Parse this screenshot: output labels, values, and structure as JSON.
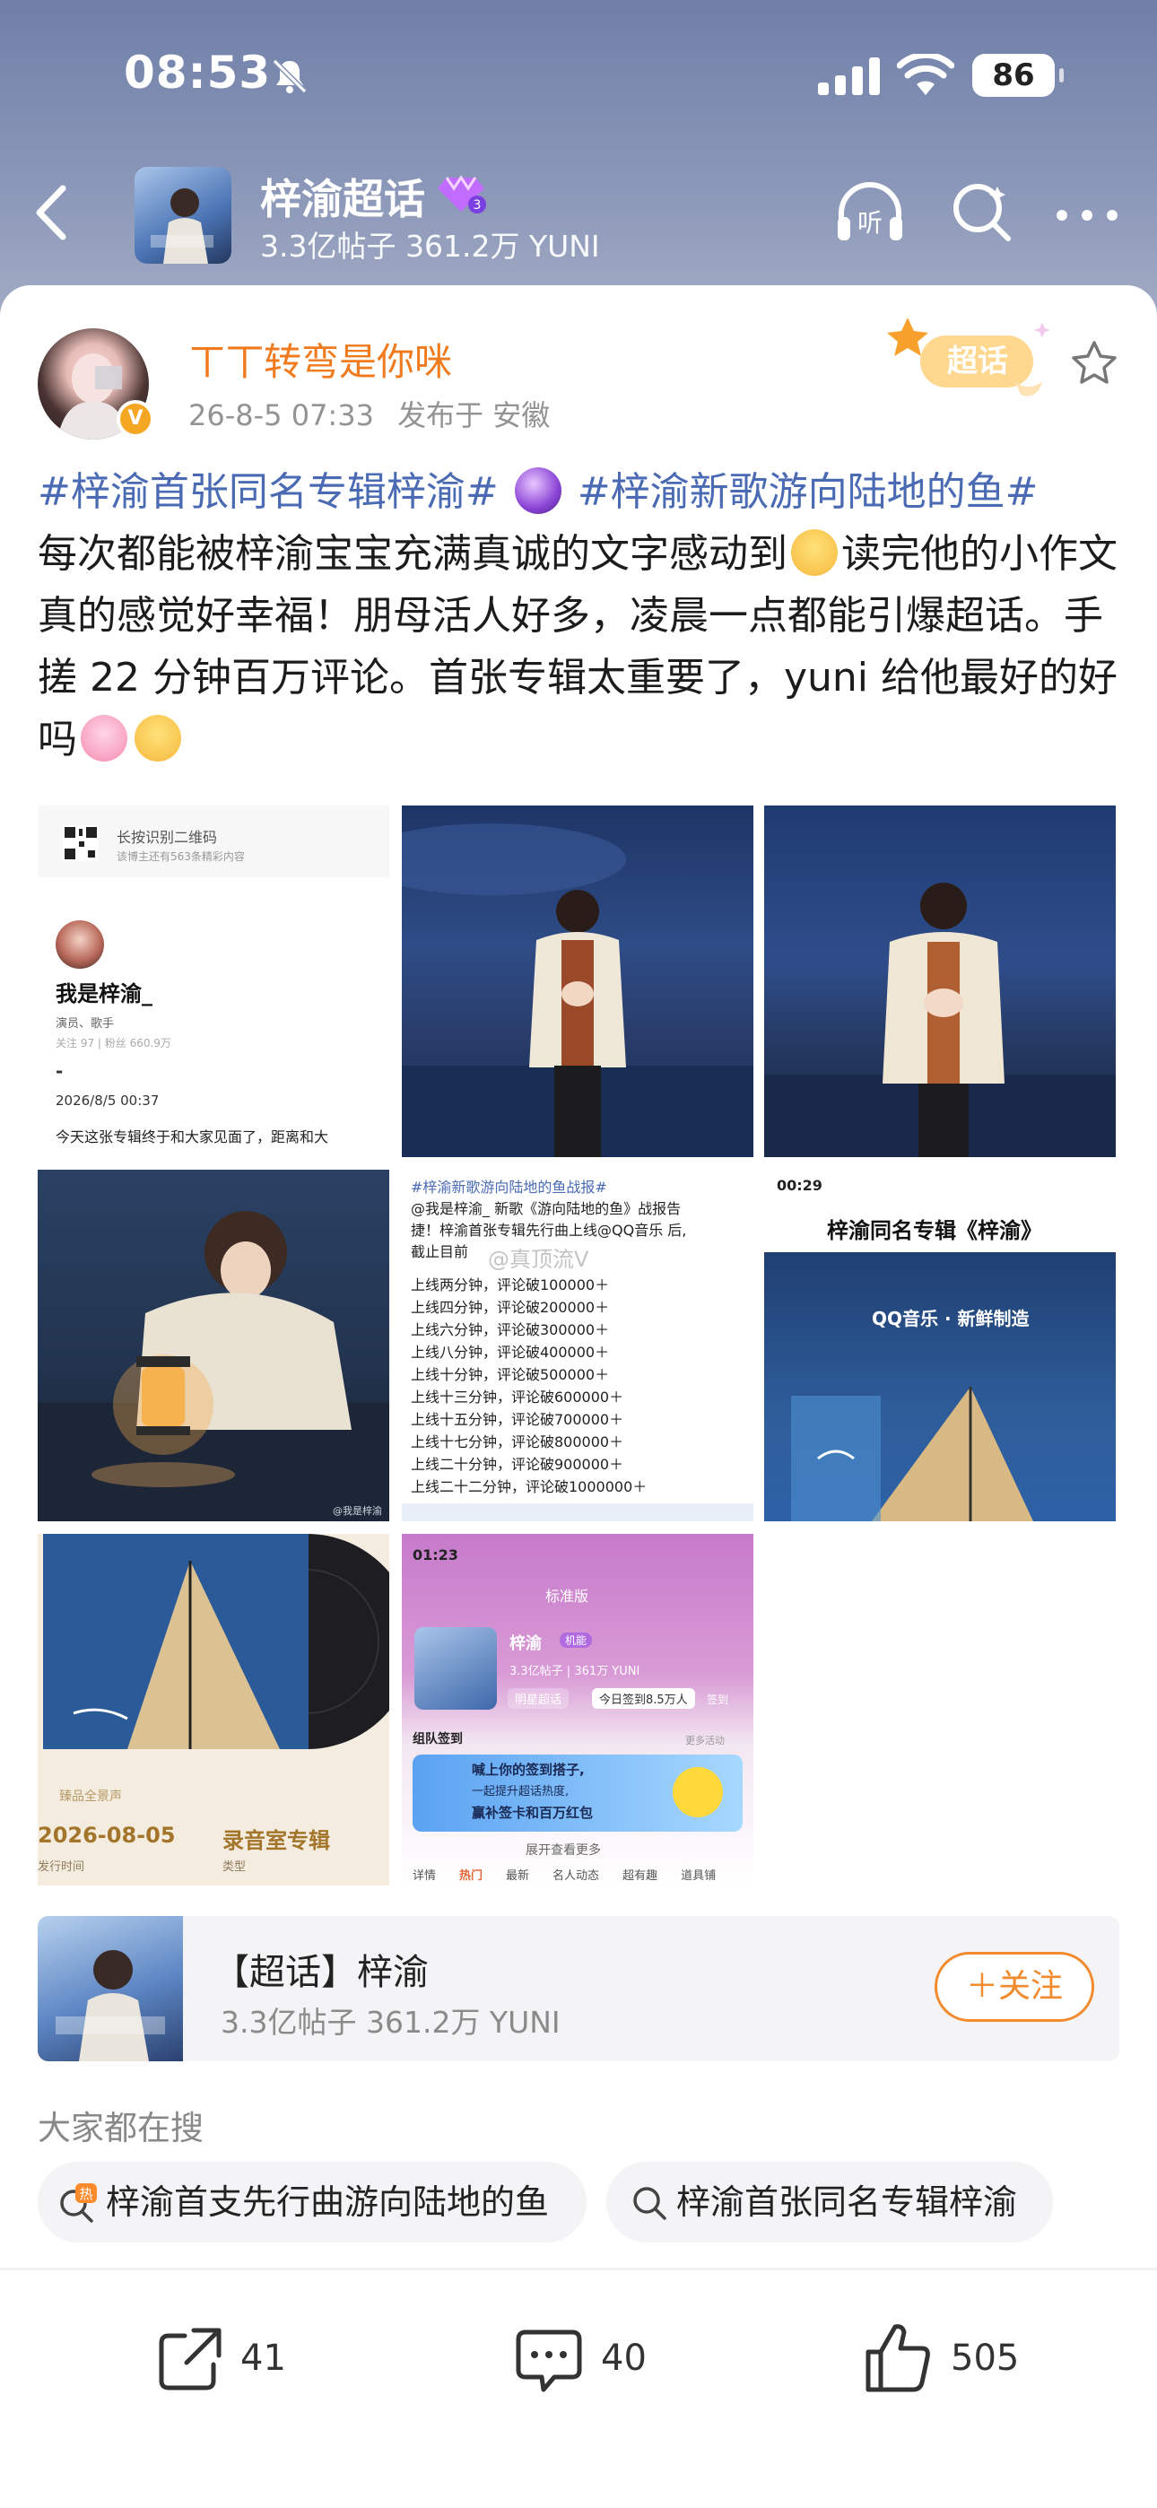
{
  "status_bar": {
    "time": "08:53",
    "battery": "86"
  },
  "top_bar": {
    "title": "梓渝超话",
    "stats": "3.3亿帖子 361.2万 YUNI"
  },
  "post": {
    "author": "ㄒ丅转弯是你咪",
    "date": "26-8-5 07:33",
    "location": "发布于 安徽",
    "badge": "超话",
    "tag1": "#梓渝首张同名专辑梓渝#",
    "tag2": "#梓渝新歌游向陆地的鱼#",
    "text1": "每次都能被梓渝宝宝充满真诚的文字感动到",
    "text2": "读完他的小作文真的感觉好幸福！朋母活人好多，凌晨一点都能引爆超话。手搓 22 分钟百万评论。首张专辑太重要了，yuni 给他最好的好吗"
  },
  "images": {
    "img1": {
      "qr_label": "长按识别二维码",
      "qr_sub": "该博主还有563条精彩内容",
      "name": "我是梓渝_",
      "role": "演员、歌手",
      "stats": "关注 97 | 粉丝 660.9万",
      "dash": "-",
      "date": "2026/8/5 00:37",
      "text": "今天这张专辑终于和大家见面了，距离和大"
    },
    "img4": {
      "watermark": "@我是梓渝"
    },
    "img5": {
      "header": "#梓渝新歌游向陆地的鱼战报#",
      "intro1": "@我是梓渝_ 新歌《游向陆地的鱼》战报告",
      "intro2": "捷！梓渝首张专辑先行曲上线@QQ音乐 后,",
      "intro3": "截止目前",
      "watermark": "@真顶流V",
      "lines": [
        "上线两分钟，评论破100000＋",
        "上线四分钟，评论破200000＋",
        "上线六分钟，评论破300000＋",
        "上线八分钟，评论破400000＋",
        "上线十分钟，评论破500000＋",
        "上线十三分钟，评论破600000＋",
        "上线十五分钟，评论破700000＋",
        "上线十七分钟，评论破800000＋",
        "上线二十分钟，评论破900000＋",
        "上线二十二分钟，评论破1000000＋"
      ]
    },
    "img6": {
      "time": "00:29",
      "title": "梓渝同名专辑《梓渝》",
      "brand": "QQ音乐 · 新鲜制造"
    },
    "img7": {
      "tag": "臻品全景声",
      "date": "2026-08-05",
      "date_label": "发行时间",
      "kind": "录音室专辑",
      "kind_label": "类型"
    },
    "img8": {
      "time": "01:23",
      "tab": "标准版",
      "name": "梓渝",
      "badge": "机能",
      "stats": "3.3亿帖子 | 361万 YUNI",
      "btn1": "明星超话",
      "btn2": "今日签到8.5万人",
      "sign": "签到",
      "group": "组队签到",
      "more": "更多活动",
      "banner1": "喊上你的签到搭子,",
      "banner2": "一起提升超话热度,",
      "banner3": "赢补签卡和百万红包",
      "expand": "展开查看更多",
      "tabs": [
        "详情",
        "热门",
        "最新",
        "名人动态",
        "超有趣",
        "道具铺"
      ]
    }
  },
  "forward_card": {
    "title": "【超话】梓渝",
    "stats": "3.3亿帖子 361.2万 YUNI",
    "follow": "＋关注"
  },
  "search": {
    "heading": "大家都在搜",
    "chip1": "梓渝首支先行曲游向陆地的鱼",
    "chip1_badge": "热",
    "chip2": "梓渝首张同名专辑梓渝"
  },
  "actions": {
    "share": "41",
    "comment": "40",
    "like": "505"
  },
  "colors": {
    "accent": "#f07a1e",
    "tag": "#4a6bb3",
    "follow": "#f28a2e"
  }
}
